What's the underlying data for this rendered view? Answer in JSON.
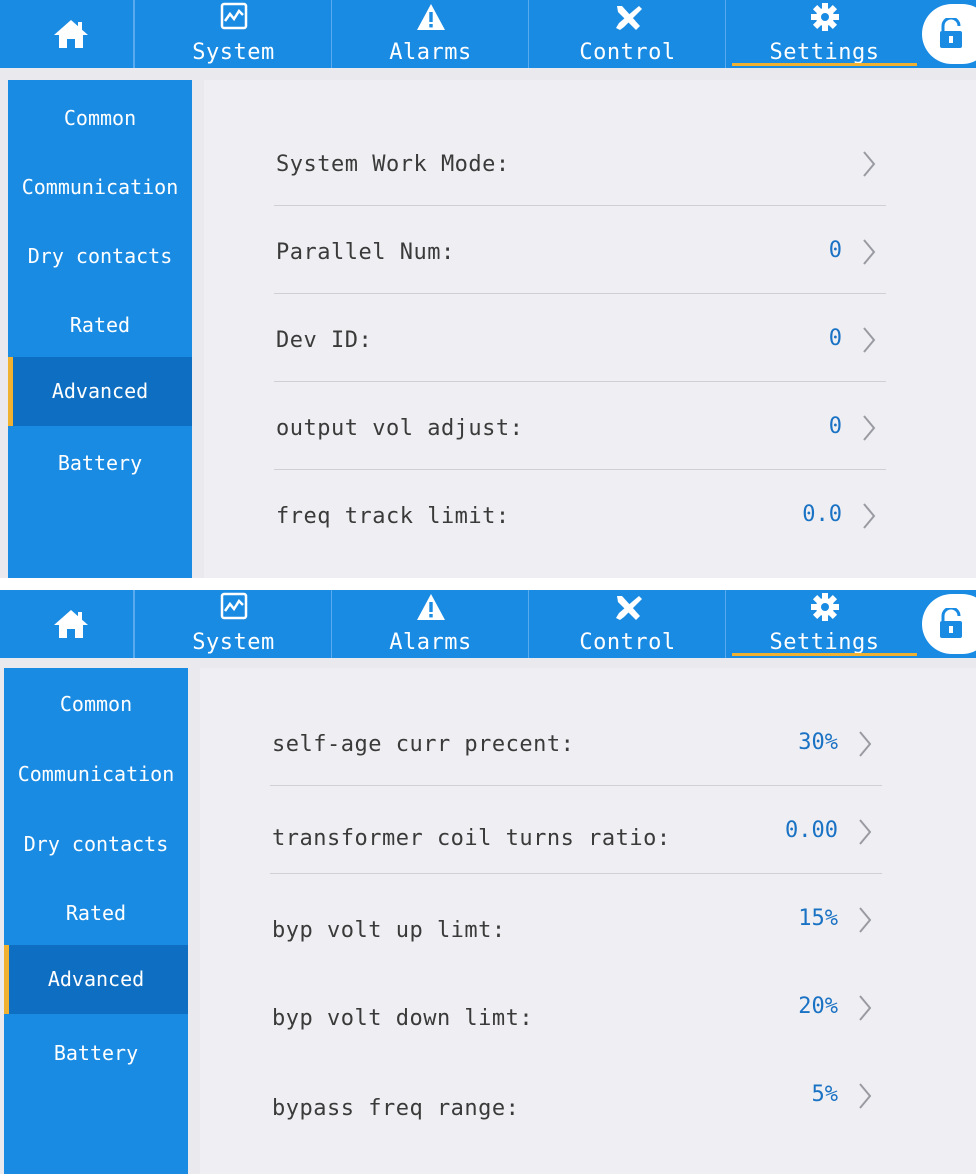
{
  "colors": {
    "accent": "#1a8be3",
    "active": "#0e6fc2",
    "indicator": "#f0b030",
    "value": "#1a72c4"
  },
  "navbar": {
    "home_icon": "home-icon",
    "tabs": [
      {
        "label": "System",
        "icon": "chart-icon"
      },
      {
        "label": "Alarms",
        "icon": "warning-icon"
      },
      {
        "label": "Control",
        "icon": "tools-icon"
      },
      {
        "label": "Settings",
        "icon": "gear-icon",
        "active": true
      }
    ],
    "lock_icon": "lock-icon"
  },
  "sidebar": {
    "items": [
      {
        "label": "Common"
      },
      {
        "label": "Communication"
      },
      {
        "label": "Dry contacts"
      },
      {
        "label": "Rated"
      },
      {
        "label": "Advanced",
        "active": true
      },
      {
        "label": "Battery"
      }
    ]
  },
  "screen1": {
    "rows": [
      {
        "label": "System Work Mode:",
        "value": ""
      },
      {
        "label": "Parallel Num:",
        "value": "0"
      },
      {
        "label": "Dev ID:",
        "value": "0"
      },
      {
        "label": "output vol adjust:",
        "value": "0"
      },
      {
        "label": "freq track limit:",
        "value": "0.0"
      }
    ]
  },
  "screen2": {
    "rows": [
      {
        "label": "self-age curr precent:",
        "value": "30%"
      },
      {
        "label": "transformer coil turns ratio:",
        "value": "0.00"
      },
      {
        "label": "byp volt up limt:",
        "value": "15%"
      },
      {
        "label": "byp volt down limt:",
        "value": "20%"
      },
      {
        "label": "bypass freq range:",
        "value": "5%"
      }
    ]
  }
}
